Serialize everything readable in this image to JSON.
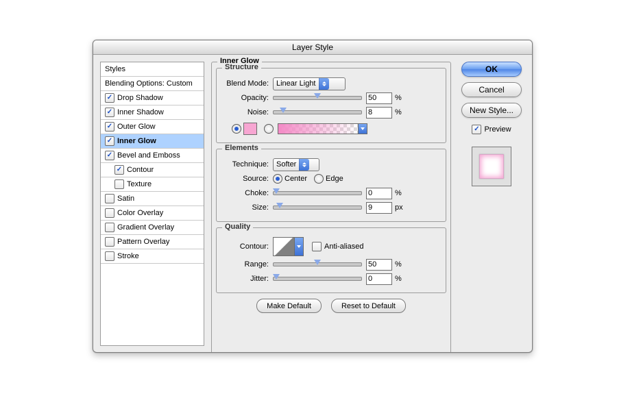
{
  "window": {
    "title": "Layer Style"
  },
  "sidebar": {
    "header": "Styles",
    "blending": "Blending Options: Custom",
    "items": [
      {
        "label": "Drop Shadow",
        "checked": true,
        "selected": false
      },
      {
        "label": "Inner Shadow",
        "checked": true,
        "selected": false
      },
      {
        "label": "Outer Glow",
        "checked": true,
        "selected": false
      },
      {
        "label": "Inner Glow",
        "checked": true,
        "selected": true
      },
      {
        "label": "Bevel and Emboss",
        "checked": true,
        "selected": false
      },
      {
        "label": "Contour",
        "checked": true,
        "selected": false,
        "indent": true
      },
      {
        "label": "Texture",
        "checked": false,
        "selected": false,
        "indent": true
      },
      {
        "label": "Satin",
        "checked": false,
        "selected": false
      },
      {
        "label": "Color Overlay",
        "checked": false,
        "selected": false
      },
      {
        "label": "Gradient Overlay",
        "checked": false,
        "selected": false
      },
      {
        "label": "Pattern Overlay",
        "checked": false,
        "selected": false
      },
      {
        "label": "Stroke",
        "checked": false,
        "selected": false
      }
    ]
  },
  "panel": {
    "title": "Inner Glow",
    "structure": {
      "legend": "Structure",
      "blend_mode": {
        "label": "Blend Mode:",
        "value": "Linear Light"
      },
      "opacity": {
        "label": "Opacity:",
        "value": "50",
        "unit": "%",
        "pct": 50
      },
      "noise": {
        "label": "Noise:",
        "value": "8",
        "unit": "%",
        "pct": 8
      },
      "color_radio_on": true,
      "gradient_radio_on": false,
      "swatch": "#f7a6d2"
    },
    "elements": {
      "legend": "Elements",
      "technique": {
        "label": "Technique:",
        "value": "Softer"
      },
      "source": {
        "label": "Source:",
        "center": "Center",
        "edge": "Edge",
        "selected": "center"
      },
      "choke": {
        "label": "Choke:",
        "value": "0",
        "unit": "%",
        "pct": 0
      },
      "size": {
        "label": "Size:",
        "value": "9",
        "unit": "px",
        "pct": 4
      }
    },
    "quality": {
      "legend": "Quality",
      "contour": {
        "label": "Contour:"
      },
      "antialiased": {
        "label": "Anti-aliased",
        "checked": false
      },
      "range": {
        "label": "Range:",
        "value": "50",
        "unit": "%",
        "pct": 50
      },
      "jitter": {
        "label": "Jitter:",
        "value": "0",
        "unit": "%",
        "pct": 0
      }
    },
    "buttons": {
      "make_default": "Make Default",
      "reset": "Reset to Default"
    }
  },
  "right": {
    "ok": "OK",
    "cancel": "Cancel",
    "new_style": "New Style...",
    "preview": "Preview",
    "preview_checked": true
  }
}
